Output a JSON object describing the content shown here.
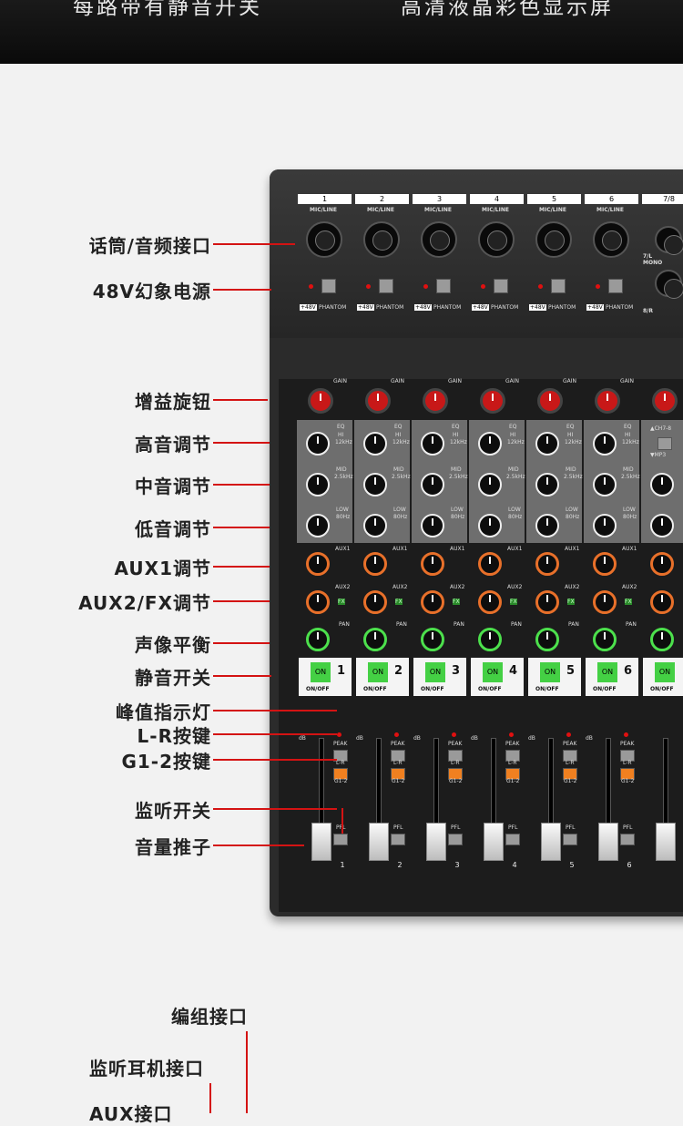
{
  "banner": {
    "left_text": "每路带有静音开关",
    "right_text": "高清液晶彩色显示屏"
  },
  "annotations": [
    "话筒/音频接口",
    "48V幻象电源",
    "增益旋钮",
    "高音调节",
    "中音调节",
    "低音调节",
    "AUX1调节",
    "AUX2/FX调节",
    "声像平衡",
    "静音开关",
    "峰值指示灯",
    "L-R按键",
    "G1-2按键",
    "监听开关",
    "音量推子"
  ],
  "bottom_annotations": [
    "编组接口",
    "监听耳机接口",
    "AUX接口"
  ],
  "mixer": {
    "channels": [
      "1",
      "2",
      "3",
      "4",
      "5",
      "6"
    ],
    "stereo_channel": "7/8",
    "stereo_label_top": "7/L\nMONO",
    "stereo_label_bottom": "8/R",
    "mic_line": "MIC/LINE",
    "phantom_48v": "+48V",
    "phantom": "PHANTOM",
    "gain": "GAIN",
    "eq": "EQ",
    "hi": "HI",
    "hi_freq": "12kHz",
    "mid": "MID",
    "mid_freq": "2.5kHz",
    "low": "LOW",
    "low_freq": "80Hz",
    "aux1": "AUX1",
    "aux2": "AUX2",
    "fx": "FX",
    "pan": "PAN",
    "on": "ON",
    "on_off": "ON/OFF",
    "peak": "PEAK",
    "lr": "L-R",
    "g12": "G1-2",
    "pfl": "PFL",
    "db": "dB",
    "ch78": "▲CH7-8",
    "mp3": "▼MP3"
  },
  "colors": {
    "accent_red": "#d41313",
    "on_green": "#44d044",
    "orange_btn": "#f08020"
  }
}
